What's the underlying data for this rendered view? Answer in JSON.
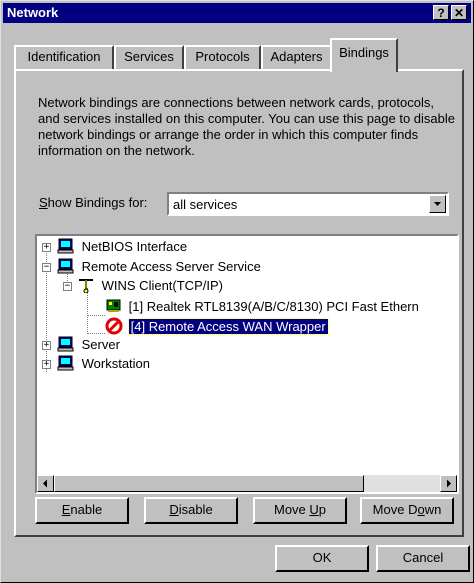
{
  "window": {
    "title": "Network"
  },
  "title_buttons": {
    "help": "?",
    "close": "✕"
  },
  "tabs": [
    {
      "label": "Identification"
    },
    {
      "label": "Services"
    },
    {
      "label": "Protocols"
    },
    {
      "label": "Adapters"
    },
    {
      "label": "Bindings"
    }
  ],
  "description": "Network bindings are connections between network cards, protocols, and services installed on this computer.  You can use this page to disable network bindings or arrange the order in which this computer finds information on the network.",
  "show_bindings": {
    "label_underlined": "S",
    "label_rest": "how Bindings for:",
    "selected": "all services"
  },
  "tree": [
    {
      "label": "NetBIOS Interface",
      "expander": "+"
    },
    {
      "label": "Remote Access Server Service",
      "expander": "−"
    },
    {
      "label": "WINS Client(TCP/IP)",
      "expander": "−"
    },
    {
      "label": "[1] Realtek RTL8139(A/B/C/8130) PCI Fast Ethern"
    },
    {
      "label": "[4] Remote Access WAN Wrapper"
    },
    {
      "label": "Server",
      "expander": "+"
    },
    {
      "label": "Workstation",
      "expander": "+"
    }
  ],
  "buttons": {
    "enable": {
      "u": "E",
      "rest": "nable"
    },
    "disable": {
      "u": "D",
      "rest": "isable"
    },
    "move_up": {
      "pre": "Move ",
      "u": "U",
      "rest": "p"
    },
    "move_down": {
      "pre": "Move D",
      "u": "o",
      "rest": "wn"
    },
    "ok": "OK",
    "cancel": "Cancel"
  },
  "colors": {
    "titlebar": "#000080",
    "selection": "#000080",
    "face": "#c0c0c0",
    "disabled_icon": "#e00000"
  }
}
